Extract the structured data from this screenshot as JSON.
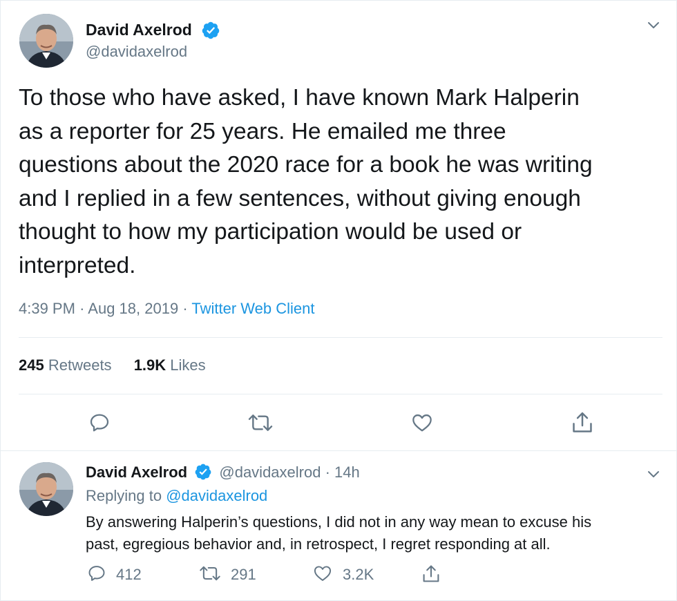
{
  "tweet": {
    "author_name": "David Axelrod",
    "author_handle": "@davidaxelrod",
    "text": "To those who have asked, I have known Mark Halperin\nas a reporter for 25 years.  He emailed me three\nquestions about the 2020 race for a book he was writing\nand I replied in a few sentences, without giving enough\nthought to how my participation would be used or\ninterpreted.",
    "time": "4:39 PM",
    "date": "Aug 18, 2019",
    "dot": "·",
    "source": "Twitter Web Client",
    "retweets_count": "245",
    "retweets_label": "Retweets",
    "likes_count": "1.9K",
    "likes_label": "Likes",
    "actions": [
      "reply-icon",
      "retweet-icon",
      "like-icon",
      "share-icon"
    ]
  },
  "reply": {
    "author_name": "David Axelrod",
    "author_handle": "@davidaxelrod",
    "dot": "·",
    "age": "14h",
    "replying_to_label": "Replying to",
    "replying_to_handle": "@davidaxelrod",
    "text": "By answering Halperin’s questions, I did not in any way mean to excuse his\npast, egregious behavior and, in retrospect, I regret responding at all.",
    "reply_count": "412",
    "retweet_count": "291",
    "like_count": "3.2K"
  },
  "colors": {
    "accent": "#1da1f2",
    "link": "#1b95e0",
    "muted": "#657786",
    "text": "#14171a",
    "divider": "#e6ecf0"
  }
}
